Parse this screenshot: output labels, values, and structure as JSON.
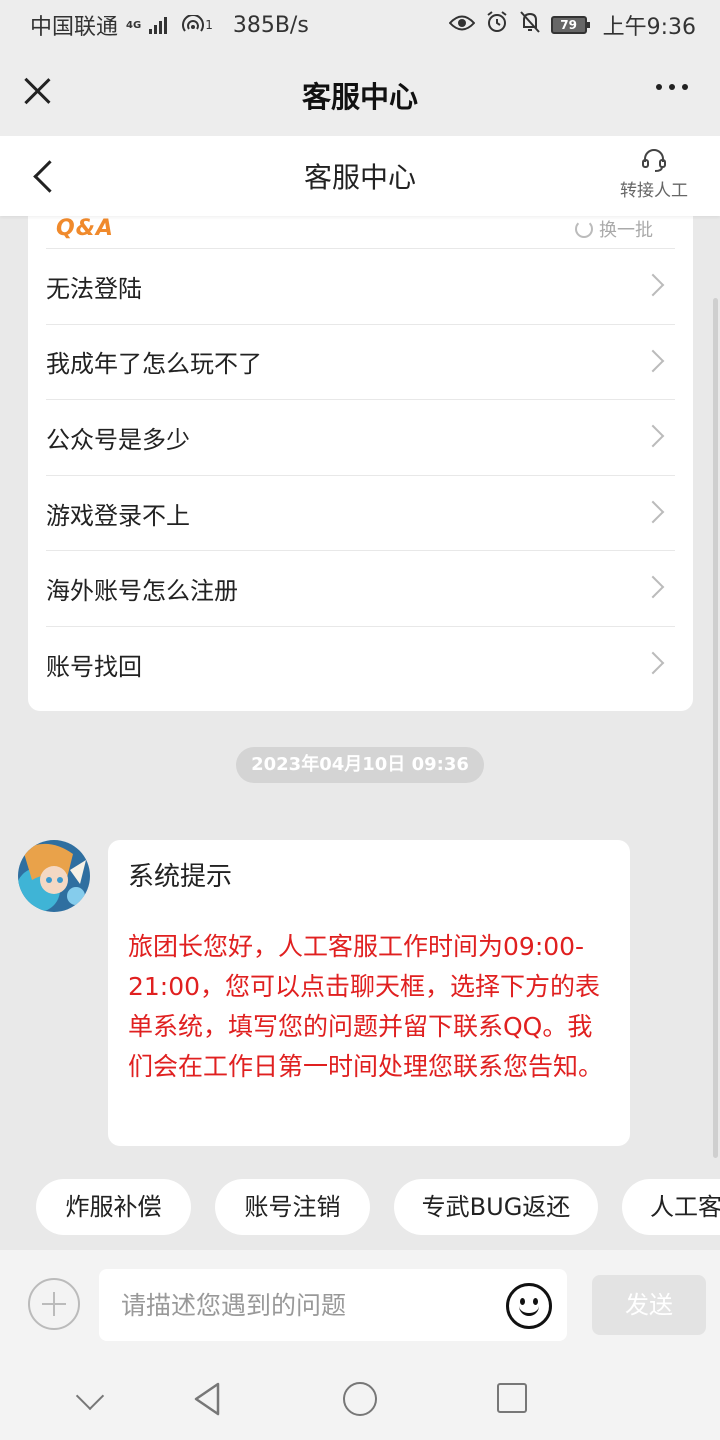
{
  "status_bar": {
    "carrier": "中国联通",
    "network": "4G",
    "hotspot": "1",
    "speed": "385B/s",
    "battery": "79",
    "time": "上午9:36"
  },
  "top_bar": {
    "title": "客服中心"
  },
  "page_header": {
    "title": "客服中心",
    "human_label": "转接人工"
  },
  "qa": {
    "logo": "Q&A",
    "refresh_label": "换一批",
    "items": [
      {
        "label": "无法登陆"
      },
      {
        "label": "我成年了怎么玩不了"
      },
      {
        "label": "公众号是多少"
      },
      {
        "label": "游戏登录不上"
      },
      {
        "label": "海外账号怎么注册"
      },
      {
        "label": "账号找回"
      }
    ]
  },
  "chat": {
    "timestamp": "2023年04月10日 09:36",
    "message": {
      "title": "系统提示",
      "body": "旅团长您好，人工客服工作时间为09:00-21:00，您可以点击聊天框，选择下方的表单系统，填写您的问题并留下联系QQ。我们会在工作日第一时间处理您联系您告知。"
    }
  },
  "quick_replies": [
    "炸服补偿",
    "账号注销",
    "专武BUG返还",
    "人工客服"
  ],
  "input": {
    "placeholder": "请描述您遇到的问题",
    "send_label": "发送"
  },
  "colors": {
    "accent_orange": "#f08a2c",
    "message_red": "#e02020"
  }
}
